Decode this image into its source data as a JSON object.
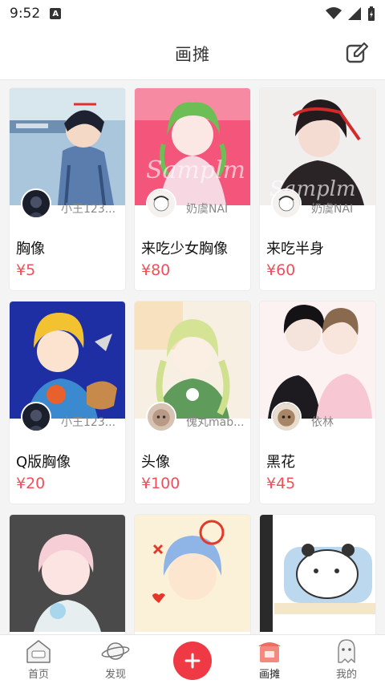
{
  "status": {
    "time": "9:52",
    "notif_letter": "A"
  },
  "header": {
    "title": "画摊"
  },
  "cards": [
    {
      "title": "胸像",
      "price": "¥5",
      "author": "小王123..."
    },
    {
      "title": "来吃少女胸像",
      "price": "¥80",
      "author": "奶虞NAI"
    },
    {
      "title": "来吃半身",
      "price": "¥60",
      "author": "奶虞NAI"
    },
    {
      "title": "Q版胸像",
      "price": "¥20",
      "author": "小王123..."
    },
    {
      "title": "头像",
      "price": "¥100",
      "author": "傀丸mab..."
    },
    {
      "title": "黑花",
      "price": "¥45",
      "author": "依林"
    },
    {
      "title": "",
      "price": "",
      "author": ""
    },
    {
      "title": "",
      "price": "",
      "author": ""
    },
    {
      "title": "",
      "price": "",
      "author": ""
    }
  ],
  "tabs": [
    {
      "label": "首页"
    },
    {
      "label": "发现"
    },
    {
      "label": ""
    },
    {
      "label": "画摊"
    },
    {
      "label": "我的"
    }
  ],
  "colors": {
    "accent": "#ef3a45",
    "price": "#f0505a"
  }
}
